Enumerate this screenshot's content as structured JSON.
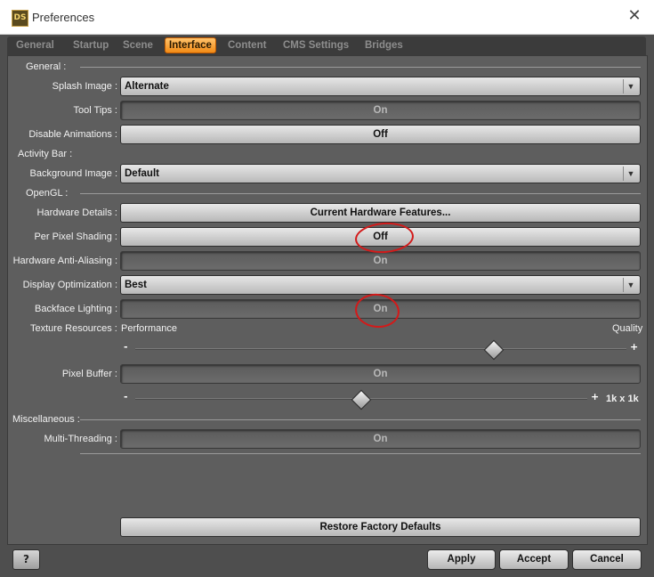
{
  "window": {
    "title": "Preferences",
    "icon_text": "DS",
    "close_glyph": "✕"
  },
  "tabs": [
    {
      "label": "General"
    },
    {
      "label": "Startup"
    },
    {
      "label": "Scene"
    },
    {
      "label": "Interface"
    },
    {
      "label": "Content"
    },
    {
      "label": "CMS Settings"
    },
    {
      "label": "Bridges"
    }
  ],
  "active_tab": "Interface",
  "sections": {
    "general": "General :",
    "activity_bar": "Activity Bar :",
    "opengl": "OpenGL :",
    "miscellaneous": "Miscellaneous :"
  },
  "rows": {
    "splash_image": {
      "label": "Splash Image :",
      "value": "Alternate"
    },
    "tool_tips": {
      "label": "Tool Tips :",
      "value": "On"
    },
    "disable_animations": {
      "label": "Disable Animations :",
      "value": "Off"
    },
    "background_image": {
      "label": "Background Image :",
      "value": "Default"
    },
    "hardware_details": {
      "label": "Hardware Details :",
      "value": "Current Hardware Features..."
    },
    "per_pixel_shading": {
      "label": "Per Pixel Shading :",
      "value": "Off"
    },
    "hardware_anti_aliasing": {
      "label": "Hardware Anti-Aliasing :",
      "value": "On"
    },
    "display_optimization": {
      "label": "Display Optimization :",
      "value": "Best"
    },
    "backface_lighting": {
      "label": "Backface Lighting :",
      "value": "On"
    },
    "texture_resources": {
      "label": "Texture Resources :",
      "min_label": "Performance",
      "max_label": "Quality",
      "minus": "-",
      "plus": "+",
      "level": 0.73
    },
    "pixel_buffer": {
      "label": "Pixel Buffer :",
      "value": "On",
      "minus": "-",
      "plus": "+",
      "size_label": "1k x 1k",
      "level": 0.5
    },
    "multi_threading": {
      "label": "Multi-Threading :",
      "value": "On"
    }
  },
  "restore_defaults": "Restore Factory Defaults",
  "footer": {
    "help": "?",
    "apply": "Apply",
    "accept": "Accept",
    "cancel": "Cancel"
  },
  "dropdown_glyph": "▼",
  "colors": {
    "accent_tab": "#f28b16",
    "annotation": "#d31a1a",
    "panel": "#5e5e5e"
  }
}
